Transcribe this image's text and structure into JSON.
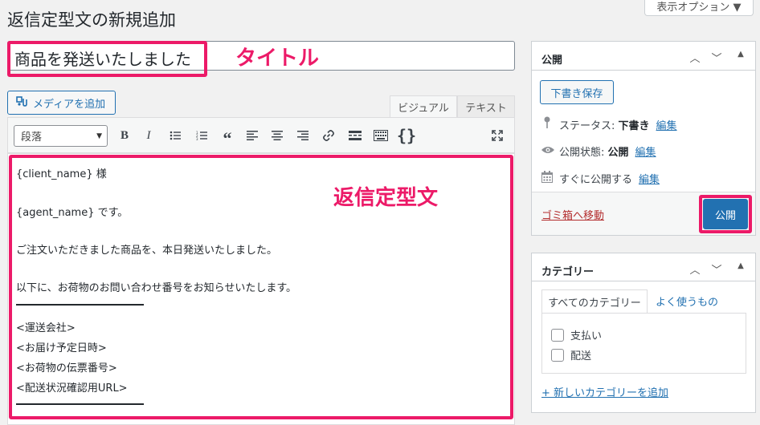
{
  "page": {
    "title": "返信定型文の新規追加",
    "screen_options": "表示オプション ▼"
  },
  "post_title": {
    "value": "商品を発送いたしました"
  },
  "annotations": {
    "title_label": "タイトル",
    "content_label": "返信定型文"
  },
  "media": {
    "add_label": "メディアを追加"
  },
  "editor_tabs": {
    "visual": "ビジュアル",
    "text": "テキスト"
  },
  "toolbar": {
    "format_select": "段落",
    "bold": "B",
    "italic": "I",
    "quote": "“",
    "code": "{}"
  },
  "content": {
    "lines": [
      "{client_name} 様",
      "{agent_name} です。",
      "ご注文いただきました商品を、本日発送いたしました。",
      "以下に、お荷物のお問い合わせ番号をお知らせいたします。",
      "<運送会社>",
      "<お届け予定日時>",
      "<お荷物の伝票番号>",
      "<配送状況確認用URL>"
    ]
  },
  "publish": {
    "title": "公開",
    "save_draft": "下書き保存",
    "status_label": "ステータス:",
    "status_value": "下書き",
    "visibility_label": "公開状態:",
    "visibility_value": "公開",
    "schedule_label": "すぐに公開する",
    "edit": "編集",
    "trash": "ゴミ箱へ移動",
    "publish_button": "公開"
  },
  "category": {
    "title": "カテゴリー",
    "tab_all": "すべてのカテゴリー",
    "tab_popular": "よく使うもの",
    "items": [
      "支払い",
      "配送"
    ],
    "add_new": "+ 新しいカテゴリーを追加"
  },
  "colors": {
    "accent": "#2271b1",
    "annotation": "#ec1a68",
    "trash": "#b32d2e"
  }
}
